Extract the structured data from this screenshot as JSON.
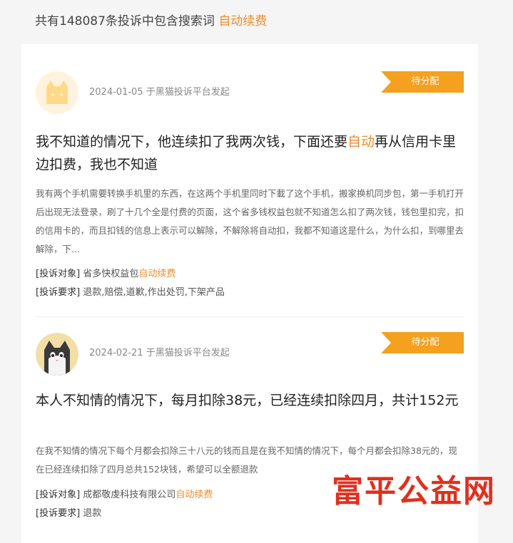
{
  "summary": {
    "prefix": "共有148087条投诉中包含搜索词",
    "keyword": "自动续费"
  },
  "items": [
    {
      "date": "2024-01-05",
      "source": "于黑猫投诉平台发起",
      "status": "待分配",
      "title_before": "我不知道的情况下，他连续扣了我两次钱，下面还要",
      "title_highlight": "自动",
      "title_after": "再从信用卡里边扣费，我也不知道",
      "body": "我有两个手机需要转换手机里的东西，在这两个手机里同时下載了这个手机，搬家换机同步包，第一手机打开后出现无法登录，刷了十几个全是付费的页面，这个省多钱权益包就不知道怎么扣了两次钱，钱包里扣完，扣的信用卡的，而且扣钱的信息上表示可以解除，不解除将自动扣，我都不知道这是什么，为什么扣，到哪里去解除，下...",
      "target_label": "[投诉对象]",
      "target_value": "省多快权益包",
      "target_highlight": "自动续费",
      "request_label": "[投诉要求]",
      "request_value": "退款,赔偿,道歉,作出处罚,下架产品"
    },
    {
      "date": "2024-02-21",
      "source": "于黑猫投诉平台发起",
      "status": "待分配",
      "title_before": "本人不知情的情况下，每月扣除38元，已经连续扣除四月，共计152元",
      "title_highlight": "",
      "title_after": "",
      "body": "在我不知情的情况下每个月都会扣除三十八元的钱而且是在我不知情的情况下，每个月都会扣除38元的，现在已经连续扣除了四月总共152块钱，希望可以全额退款",
      "target_label": "[投诉对象]",
      "target_value": "成都敬虔科技有限公司",
      "target_highlight": "自动续费",
      "request_label": "[投诉要求]",
      "request_value": "退款"
    }
  ],
  "watermark": "富平公益网",
  "colors": {
    "accent": "#f08c2a",
    "badge": "#f5a01f",
    "watermark": "#e0301e"
  }
}
